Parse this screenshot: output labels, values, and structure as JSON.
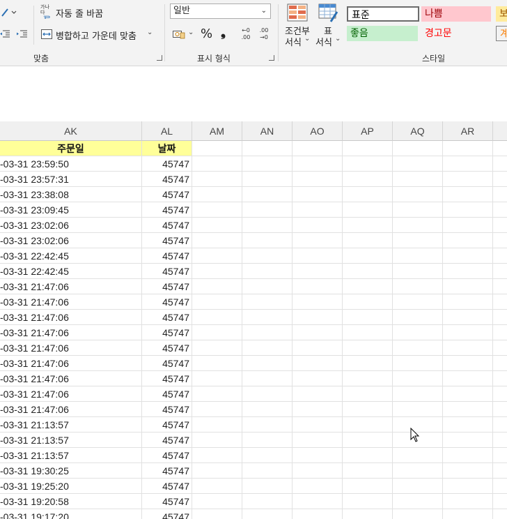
{
  "ribbon": {
    "alignment": {
      "wrap_text_label": "자동 줄 바꿈",
      "merge_center_label": "병합하고 가운데 맞춤",
      "group_label": "맞춤",
      "wrap_icon_text": "가나다"
    },
    "number": {
      "format_value": "일반",
      "percent_symbol": "%",
      "comma_symbol": "❟",
      "increase_decimal_top": "←0",
      "increase_decimal_bottom": ".00",
      "decrease_decimal_top": ".00",
      "decrease_decimal_bottom": "→0",
      "group_label": "표시 형식"
    },
    "styles": {
      "conditional_label_1": "조건부",
      "conditional_label_2": "서식",
      "table_label_1": "표",
      "table_label_2": "서식",
      "items": [
        {
          "label": "표준",
          "bg": "#ffffff",
          "fg": "#000000"
        },
        {
          "label": "나쁨",
          "bg": "#ffc7ce",
          "fg": "#9c0006"
        },
        {
          "label": "보",
          "bg": "#ffeb9c",
          "fg": "#9c5700"
        },
        {
          "label": "좋음",
          "bg": "#c6efce",
          "fg": "#006100"
        },
        {
          "label": "경고문",
          "bg": "#f3f3f3",
          "fg": "#ff0000"
        },
        {
          "label": "계",
          "bg": "#f2f2f2",
          "fg": "#fa7d00"
        }
      ],
      "group_label": "스타일"
    }
  },
  "sheet": {
    "columns": [
      "AK",
      "AL",
      "AM",
      "AN",
      "AO",
      "AP",
      "AQ",
      "AR"
    ],
    "header_row": {
      "ak": "주문일",
      "al": "날짜"
    },
    "header_fill": "#ffff99",
    "rows": [
      {
        "ak": "-03-31 23:59:50",
        "al": "45747"
      },
      {
        "ak": "-03-31 23:57:31",
        "al": "45747"
      },
      {
        "ak": "-03-31 23:38:08",
        "al": "45747"
      },
      {
        "ak": "-03-31 23:09:45",
        "al": "45747"
      },
      {
        "ak": "-03-31 23:02:06",
        "al": "45747"
      },
      {
        "ak": "-03-31 23:02:06",
        "al": "45747"
      },
      {
        "ak": "-03-31 22:42:45",
        "al": "45747"
      },
      {
        "ak": "-03-31 22:42:45",
        "al": "45747"
      },
      {
        "ak": "-03-31 21:47:06",
        "al": "45747"
      },
      {
        "ak": "-03-31 21:47:06",
        "al": "45747"
      },
      {
        "ak": "-03-31 21:47:06",
        "al": "45747"
      },
      {
        "ak": "-03-31 21:47:06",
        "al": "45747"
      },
      {
        "ak": "-03-31 21:47:06",
        "al": "45747"
      },
      {
        "ak": "-03-31 21:47:06",
        "al": "45747"
      },
      {
        "ak": "-03-31 21:47:06",
        "al": "45747"
      },
      {
        "ak": "-03-31 21:47:06",
        "al": "45747"
      },
      {
        "ak": "-03-31 21:47:06",
        "al": "45747"
      },
      {
        "ak": "-03-31 21:13:57",
        "al": "45747"
      },
      {
        "ak": "-03-31 21:13:57",
        "al": "45747"
      },
      {
        "ak": "-03-31 21:13:57",
        "al": "45747"
      },
      {
        "ak": "-03-31 19:30:25",
        "al": "45747"
      },
      {
        "ak": "-03-31 19:25:20",
        "al": "45747"
      },
      {
        "ak": "-03-31 19:20:58",
        "al": "45747"
      },
      {
        "ak": "-03-31 19:17:20",
        "al": "45747"
      }
    ]
  }
}
